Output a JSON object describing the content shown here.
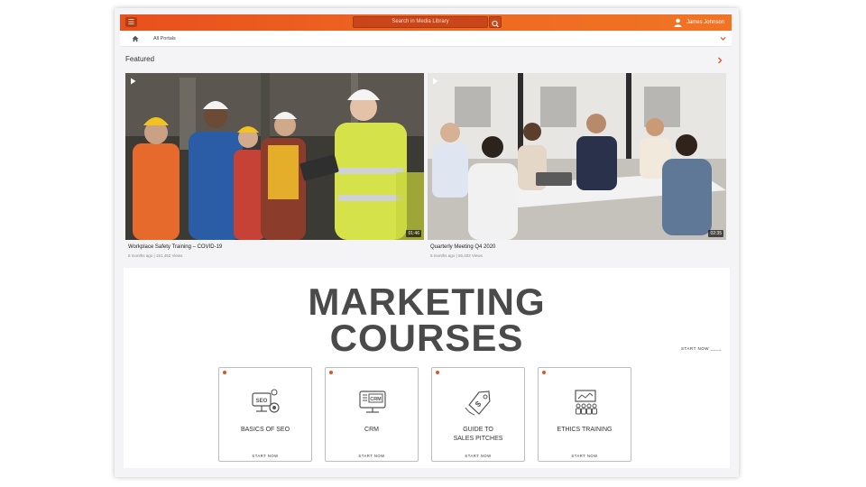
{
  "header": {
    "search_placeholder": "Search in Media Library",
    "user_name": "James Johnson"
  },
  "subnav": {
    "portal_label": "All Portals"
  },
  "featured": {
    "section_title": "Featured",
    "videos": [
      {
        "title": "Workplace Safety Training –  COVID-19",
        "meta": "5 months ago | 151,452 Views",
        "duration": "01:46"
      },
      {
        "title": "Quarterly Meeting Q4 2020",
        "meta": "5 months ago | 55,402 Views",
        "duration": "02:35"
      }
    ]
  },
  "banner": {
    "heading_line1": "MARKETING",
    "heading_line2": "COURSES",
    "side_cta": "START NOW ____",
    "courses": [
      {
        "title": "BASICS OF SEO",
        "cta": "START NOW",
        "icon": "seo-icon"
      },
      {
        "title": "CRM",
        "cta": "START NOW",
        "icon": "crm-monitor-icon"
      },
      {
        "title": "GUIDE TO\nSALES PITCHES",
        "cta": "START NOW",
        "icon": "sales-tag-icon"
      },
      {
        "title": "ETHICS TRAINING",
        "cta": "START NOW",
        "icon": "ethics-presentation-icon"
      }
    ]
  },
  "colors": {
    "accent": "#e8501c",
    "heading": "#4a4a4a"
  }
}
